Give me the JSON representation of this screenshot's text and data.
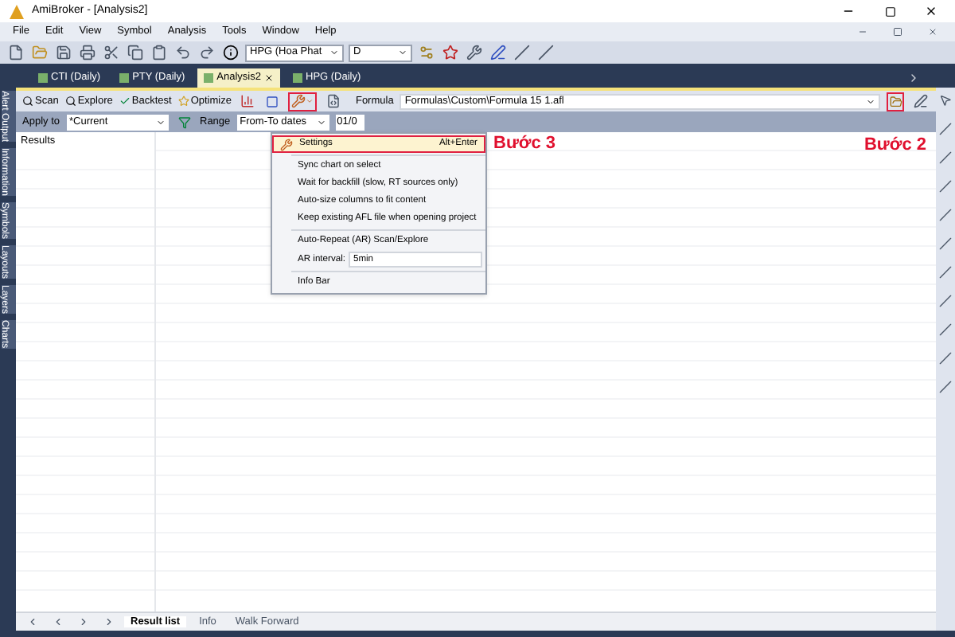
{
  "window": {
    "title": "AmiBroker - [Analysis2]"
  },
  "menu": [
    "File",
    "Edit",
    "View",
    "Symbol",
    "Analysis",
    "Tools",
    "Window",
    "Help"
  ],
  "toolbar": {
    "symbol": "HPG (Hoa Phat",
    "interval": "D"
  },
  "doc_tabs": [
    {
      "label": "CTI (Daily)",
      "selected": false
    },
    {
      "label": "PTY (Daily)",
      "selected": false
    },
    {
      "label": "Analysis2",
      "selected": true
    },
    {
      "label": "HPG (Daily)",
      "selected": false
    }
  ],
  "side_tabs": [
    "Alert Output",
    "Information",
    "Symbols",
    "Layouts",
    "Layers",
    "Charts"
  ],
  "analysis": {
    "actions": [
      "Scan",
      "Explore",
      "Backtest",
      "Optimize"
    ],
    "formula_label": "Formula",
    "formula": "Formulas\\Custom\\Formula 15 1.afl",
    "apply_label": "Apply to",
    "apply": "*Current",
    "range_label": "Range",
    "range": "From-To dates",
    "date": "01/0"
  },
  "results": {
    "header": "Results"
  },
  "dropdown": [
    {
      "kind": "item",
      "label": "Settings",
      "shortcut": "Alt+Enter",
      "selected": true
    },
    {
      "kind": "divider"
    },
    {
      "kind": "item",
      "label": "Sync chart on select",
      "selected": false
    },
    {
      "kind": "item",
      "label": "Wait for backfill (slow, RT sources only)",
      "selected": false
    },
    {
      "kind": "item",
      "label": "Auto-size columns to fit content",
      "selected": false
    },
    {
      "kind": "item",
      "label": "Keep existing AFL file when opening project",
      "selected": false
    },
    {
      "kind": "divider"
    },
    {
      "kind": "item",
      "label": "Auto-Repeat (AR) Scan/Explore",
      "selected": false
    },
    {
      "kind": "field",
      "label": "AR interval:",
      "value": "5min"
    },
    {
      "kind": "divider"
    },
    {
      "kind": "item",
      "label": "Info Bar",
      "selected": false
    }
  ],
  "annotations": [
    "Bước 3",
    "Bước 2"
  ],
  "bottom_tabs": [
    {
      "label": "Result list",
      "selected": true
    },
    {
      "label": "Info",
      "selected": false
    },
    {
      "label": "Walk Forward",
      "selected": false
    }
  ]
}
